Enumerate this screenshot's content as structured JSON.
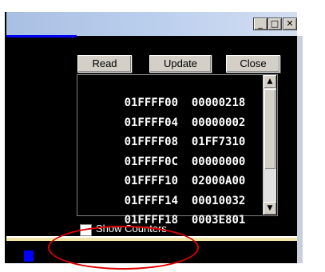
{
  "window": {
    "controls": {
      "minimize": "_",
      "maximize": "□",
      "close": "✕"
    }
  },
  "toolbar": {
    "read_label": "Read",
    "update_label": "Update",
    "close_label": "Close"
  },
  "memory_list": {
    "rows": [
      {
        "address": "01FFFF00",
        "value": "00000218"
      },
      {
        "address": "01FFFF04",
        "value": "00000002"
      },
      {
        "address": "01FFFF08",
        "value": "01FF7310"
      },
      {
        "address": "01FFFF0C",
        "value": "00000000"
      },
      {
        "address": "01FFFF10",
        "value": "02000A00"
      },
      {
        "address": "01FFFF14",
        "value": "00010032"
      },
      {
        "address": "01FFFF18",
        "value": "0003E801"
      }
    ]
  },
  "scrollbar": {
    "up_icon": "▲",
    "down_icon": "▼"
  },
  "show_counters": {
    "label": "Show Counters",
    "checked": false
  },
  "colors": {
    "background": "#000000",
    "text": "#ffffff",
    "highlight_oval": "#e00000",
    "accent_blue": "#0000ff",
    "separator_yellow": "#f2e6a6"
  }
}
